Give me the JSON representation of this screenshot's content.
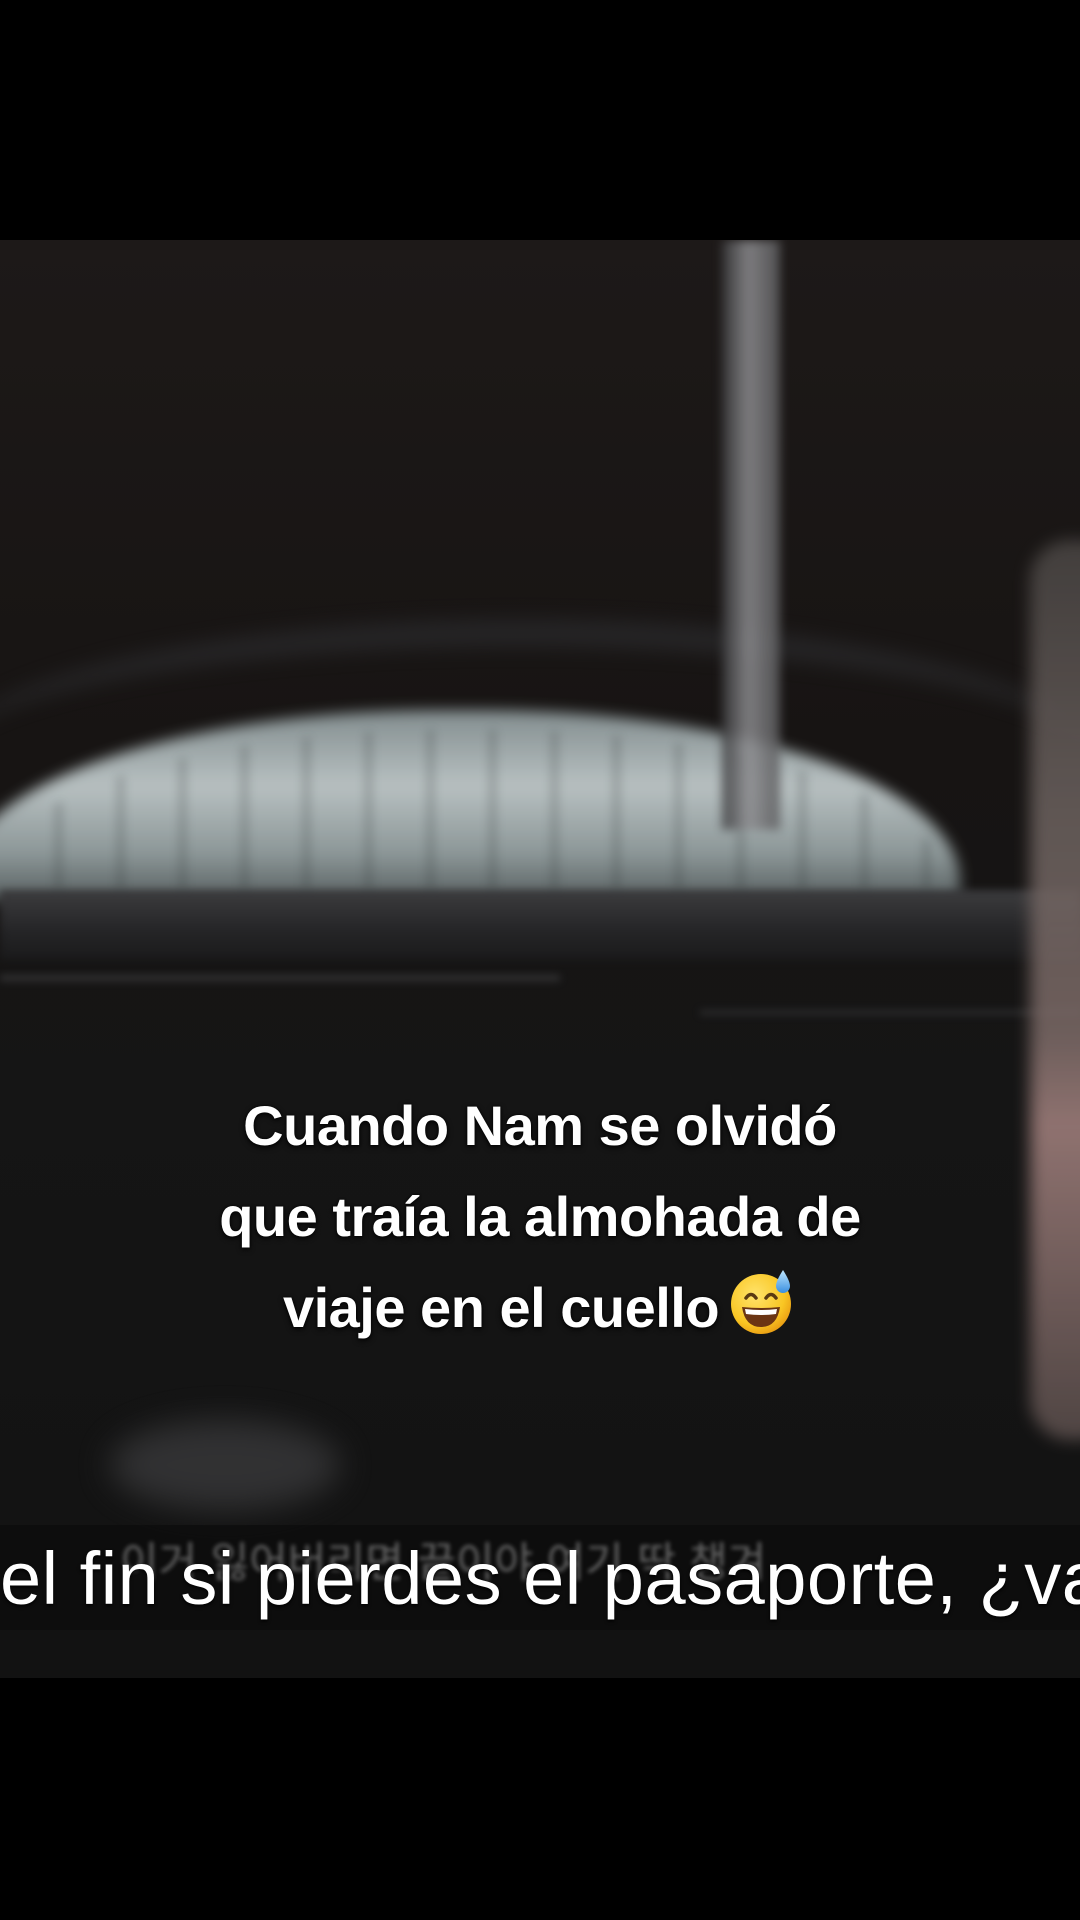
{
  "overlay_caption": {
    "line1": "Cuando Nam se olvidó",
    "line2": "que traía la almohada de",
    "line3": "viaje en el cuello",
    "emoji": "grinning-face-with-sweat"
  },
  "video_subtitle": {
    "spanish": "el fin si pierdes el pasaporte, ¿va"
  },
  "colors": {
    "background": "#000000",
    "caption_text": "#ffffff",
    "emoji_face": "#f9c623"
  }
}
